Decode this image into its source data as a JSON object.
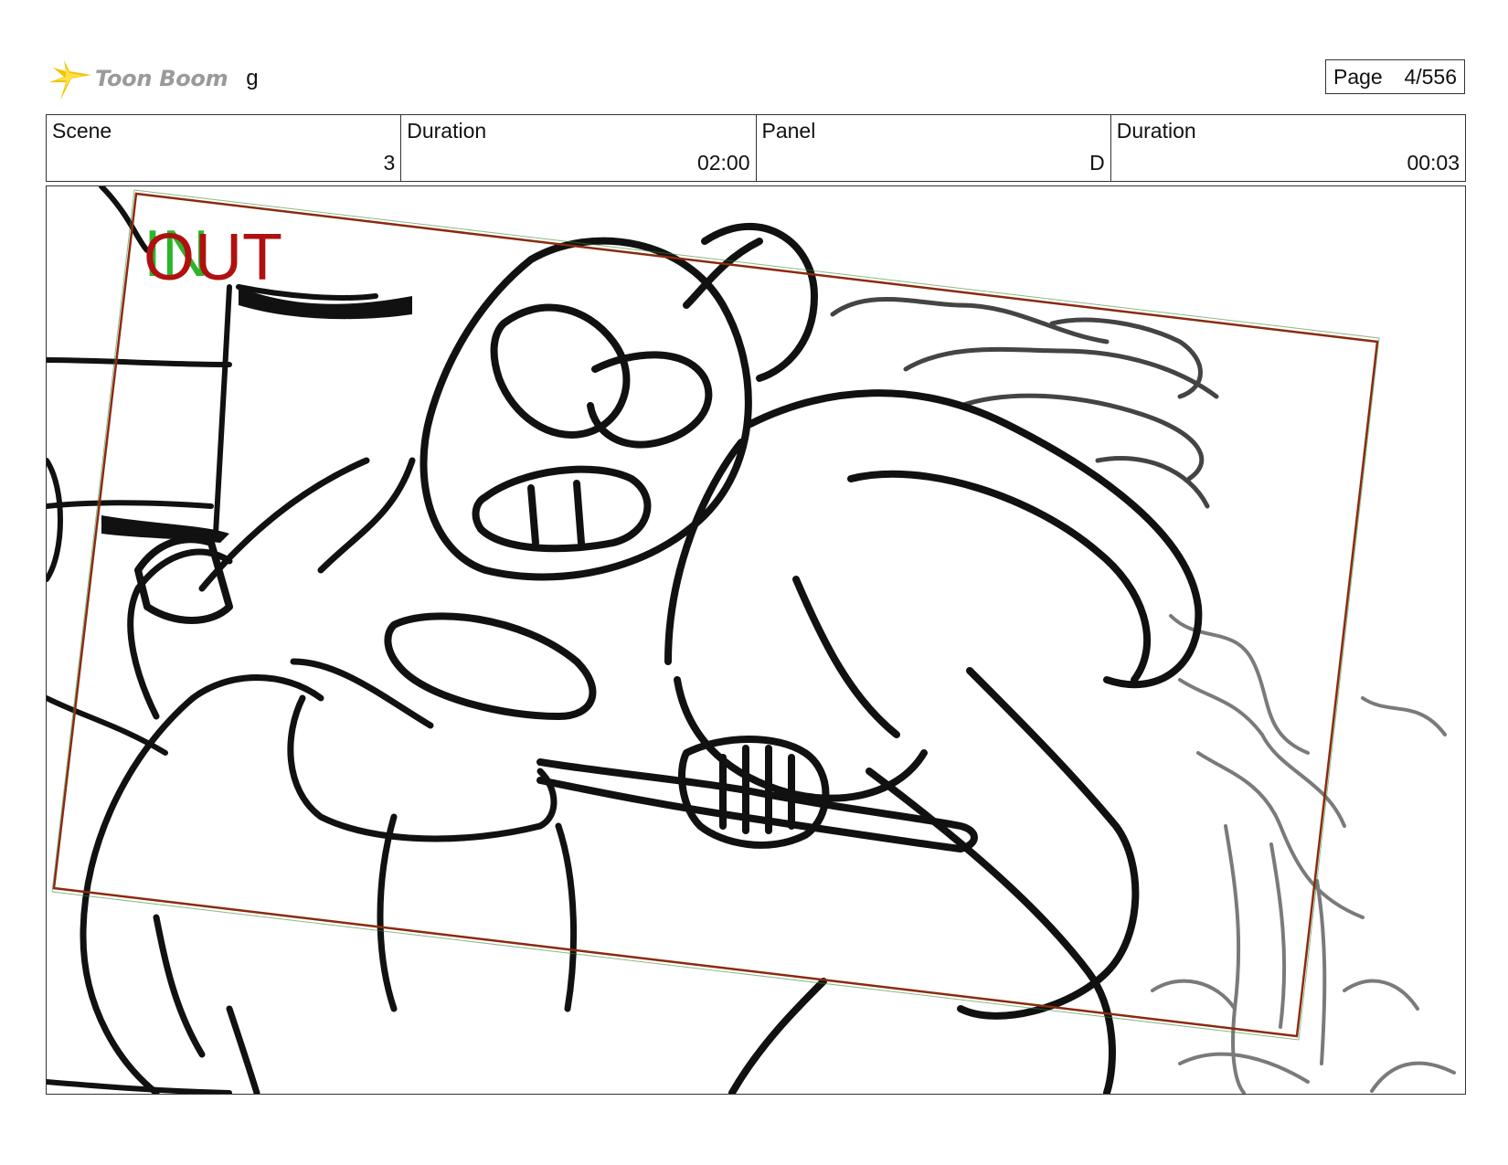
{
  "header": {
    "logo_text": "Toon Boom",
    "logo_icon": "toon-boom-star-icon",
    "title": "g",
    "page_label": "Page",
    "page_value": "4/556"
  },
  "info": {
    "scene_label": "Scene",
    "scene_value": "3",
    "scene_duration_label": "Duration",
    "scene_duration_value": "02:00",
    "panel_label": "Panel",
    "panel_value": "D",
    "panel_duration_label": "Duration",
    "panel_duration_value": "00:03"
  },
  "panel": {
    "in_text": "IN",
    "out_text": "OUT",
    "camera_frame_color": "#8b2a10",
    "in_color": "#2bb52b",
    "out_color": "#b01010"
  }
}
